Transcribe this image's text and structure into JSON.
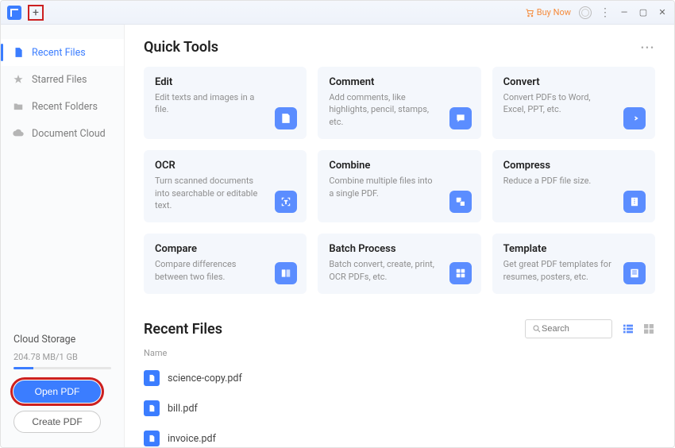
{
  "titlebar": {
    "buy_label": "Buy Now"
  },
  "sidebar": {
    "items": [
      {
        "label": "Recent Files"
      },
      {
        "label": "Starred Files"
      },
      {
        "label": "Recent Folders"
      },
      {
        "label": "Document Cloud"
      }
    ],
    "cloud": {
      "title": "Cloud Storage",
      "usage": "204.78 MB/1 GB"
    },
    "open_label": "Open PDF",
    "create_label": "Create PDF"
  },
  "quick": {
    "title": "Quick Tools",
    "cards": [
      {
        "title": "Edit",
        "desc": "Edit texts and images in a file."
      },
      {
        "title": "Comment",
        "desc": "Add comments, like highlights, pencil, stamps, etc."
      },
      {
        "title": "Convert",
        "desc": "Convert PDFs to Word, Excel, PPT, etc."
      },
      {
        "title": "OCR",
        "desc": "Turn scanned documents into searchable or editable text."
      },
      {
        "title": "Combine",
        "desc": "Combine multiple files into a single PDF."
      },
      {
        "title": "Compress",
        "desc": "Reduce a PDF file size."
      },
      {
        "title": "Compare",
        "desc": "Compare differences between two files."
      },
      {
        "title": "Batch Process",
        "desc": "Batch convert, create, print, OCR PDFs, etc."
      },
      {
        "title": "Template",
        "desc": "Get great PDF templates for resumes, posters, etc."
      }
    ]
  },
  "recent": {
    "title": "Recent Files",
    "search_placeholder": "Search",
    "col_name": "Name",
    "files": [
      {
        "name": "science-copy.pdf"
      },
      {
        "name": "bill.pdf"
      },
      {
        "name": "invoice.pdf"
      }
    ]
  }
}
